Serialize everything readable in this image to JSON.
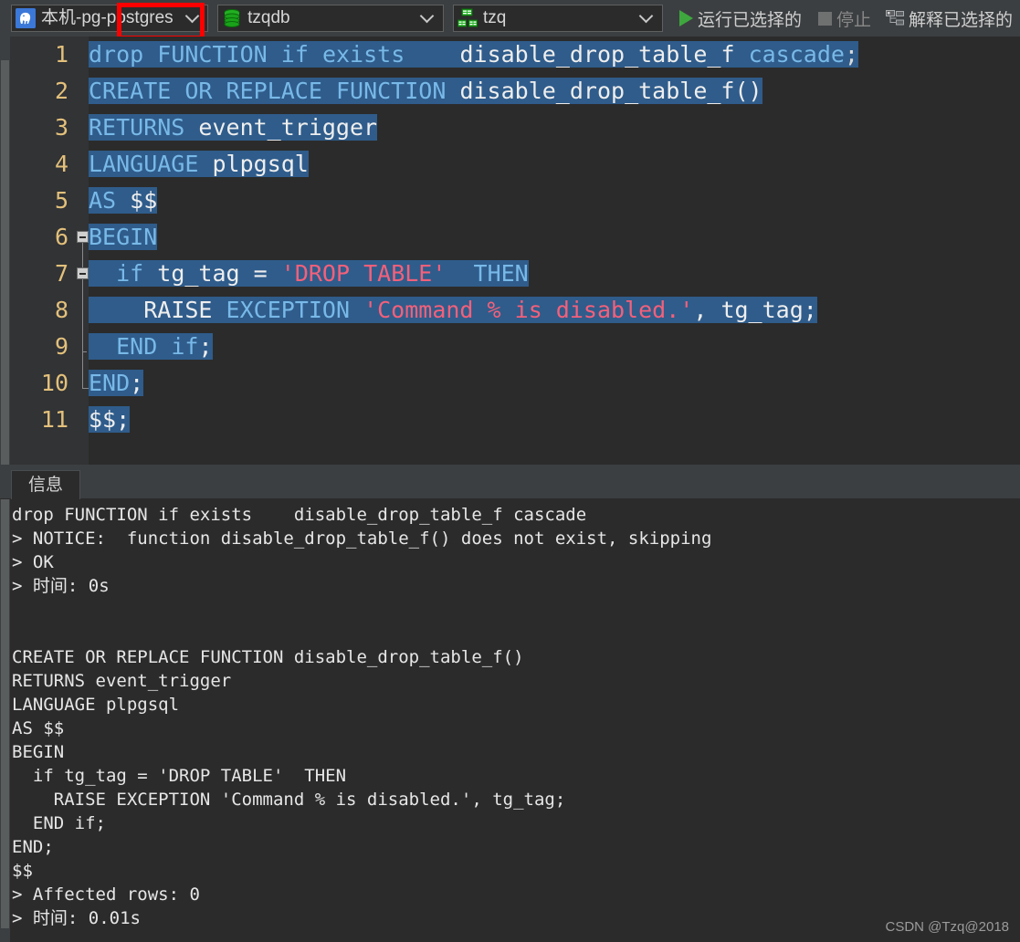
{
  "toolbar": {
    "connection": {
      "icon": "postgres-elephant-icon",
      "label": "本机-pg-postgres"
    },
    "database": {
      "icon": "database-cylinder-icon",
      "label": "tzqdb"
    },
    "schema": {
      "icon": "schema-tree-icon",
      "label": "tzq"
    },
    "run_selected": {
      "icon": "play-triangle-icon",
      "label": "运行已选择的"
    },
    "stop": {
      "icon": "stop-square-icon",
      "label": "停止"
    },
    "explain_selected": {
      "icon": "explain-plan-icon",
      "label": "解释已选择的"
    },
    "annotation_color": "#fe0000"
  },
  "editor": {
    "gutter_color": "#313335",
    "selection_color": "#2f5c8b",
    "keyword_color": "#78b9e8",
    "string_color": "#f4607a",
    "identifier_color": "#eeeeee",
    "line_numbers": [
      "1",
      "2",
      "3",
      "4",
      "5",
      "6",
      "7",
      "8",
      "9",
      "10",
      "11"
    ],
    "fold_markers": [
      6,
      7
    ],
    "lines": [
      {
        "n": "1",
        "tokens": [
          {
            "t": "drop",
            "c": "kw"
          },
          {
            "t": " ",
            "c": "pun"
          },
          {
            "t": "FUNCTION",
            "c": "kw"
          },
          {
            "t": " ",
            "c": "pun"
          },
          {
            "t": "if",
            "c": "kw"
          },
          {
            "t": " ",
            "c": "pun"
          },
          {
            "t": "exists",
            "c": "kw"
          },
          {
            "t": "    ",
            "c": "pun"
          },
          {
            "t": "disable_drop_table_f",
            "c": "id"
          },
          {
            "t": " ",
            "c": "pun"
          },
          {
            "t": "cascade",
            "c": "kw"
          },
          {
            "t": ";",
            "c": "pun"
          }
        ]
      },
      {
        "n": "2",
        "tokens": [
          {
            "t": "CREATE",
            "c": "kw"
          },
          {
            "t": " ",
            "c": "pun"
          },
          {
            "t": "OR",
            "c": "kw"
          },
          {
            "t": " ",
            "c": "pun"
          },
          {
            "t": "REPLACE",
            "c": "kw"
          },
          {
            "t": " ",
            "c": "pun"
          },
          {
            "t": "FUNCTION",
            "c": "kw"
          },
          {
            "t": " ",
            "c": "pun"
          },
          {
            "t": "disable_drop_table_f()",
            "c": "id"
          }
        ]
      },
      {
        "n": "3",
        "tokens": [
          {
            "t": "RETURNS",
            "c": "kw"
          },
          {
            "t": " ",
            "c": "pun"
          },
          {
            "t": "event_trigger",
            "c": "id"
          }
        ]
      },
      {
        "n": "4",
        "tokens": [
          {
            "t": "LANGUAGE",
            "c": "kw"
          },
          {
            "t": " ",
            "c": "pun"
          },
          {
            "t": "plpgsql",
            "c": "id"
          }
        ]
      },
      {
        "n": "5",
        "tokens": [
          {
            "t": "AS",
            "c": "kw"
          },
          {
            "t": " ",
            "c": "pun"
          },
          {
            "t": "$$",
            "c": "id"
          }
        ]
      },
      {
        "n": "6",
        "tokens": [
          {
            "t": "BEGIN",
            "c": "kw"
          }
        ]
      },
      {
        "n": "7",
        "tokens": [
          {
            "t": "  ",
            "c": "pun"
          },
          {
            "t": "if",
            "c": "kw"
          },
          {
            "t": " ",
            "c": "pun"
          },
          {
            "t": "tg_tag",
            "c": "id"
          },
          {
            "t": " ",
            "c": "pun"
          },
          {
            "t": "=",
            "c": "id"
          },
          {
            "t": " ",
            "c": "pun"
          },
          {
            "t": "'DROP TABLE'",
            "c": "str"
          },
          {
            "t": "  ",
            "c": "pun"
          },
          {
            "t": "THEN",
            "c": "kw"
          }
        ]
      },
      {
        "n": "8",
        "tokens": [
          {
            "t": "    ",
            "c": "pun"
          },
          {
            "t": "RAISE",
            "c": "id"
          },
          {
            "t": " ",
            "c": "pun"
          },
          {
            "t": "EXCEPTION",
            "c": "kw"
          },
          {
            "t": " ",
            "c": "pun"
          },
          {
            "t": "'Command % is disabled.'",
            "c": "str"
          },
          {
            "t": ",",
            "c": "id"
          },
          {
            "t": " ",
            "c": "pun"
          },
          {
            "t": "tg_tag",
            "c": "id"
          },
          {
            "t": ";",
            "c": "id"
          }
        ]
      },
      {
        "n": "9",
        "tokens": [
          {
            "t": "  ",
            "c": "pun"
          },
          {
            "t": "END",
            "c": "kw"
          },
          {
            "t": " ",
            "c": "pun"
          },
          {
            "t": "if",
            "c": "kw"
          },
          {
            "t": ";",
            "c": "id"
          }
        ]
      },
      {
        "n": "10",
        "tokens": [
          {
            "t": "END",
            "c": "kw"
          },
          {
            "t": ";",
            "c": "id"
          }
        ]
      },
      {
        "n": "11",
        "tokens": [
          {
            "t": "$$",
            "c": "id"
          },
          {
            "t": ";",
            "c": "id"
          }
        ]
      }
    ]
  },
  "panel": {
    "tab_label": "信息",
    "output": "drop FUNCTION if exists    disable_drop_table_f cascade\n> NOTICE:  function disable_drop_table_f() does not exist, skipping\n> OK\n> 时间: 0s\n\n\nCREATE OR REPLACE FUNCTION disable_drop_table_f()\nRETURNS event_trigger\nLANGUAGE plpgsql\nAS $$\nBEGIN\n  if tg_tag = 'DROP TABLE'  THEN\n    RAISE EXCEPTION 'Command % is disabled.', tg_tag;\n  END if;\nEND;\n$$\n> Affected rows: 0\n> 时间: 0.01s"
  },
  "watermark": "CSDN @Tzq@2018"
}
